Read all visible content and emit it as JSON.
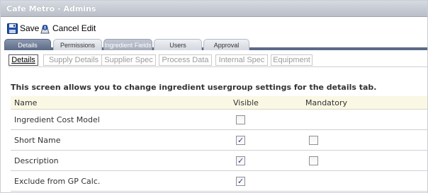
{
  "window": {
    "title": "Cafe Metro - Admins"
  },
  "toolbar": {
    "save_label": "Save",
    "cancel_label": "Cancel Edit",
    "save_icon": "floppy-disk-icon",
    "cancel_icon": "cancel-edit-icon"
  },
  "main_tabs": [
    {
      "label": "Details",
      "state": "active"
    },
    {
      "label": "Permissions",
      "state": "inactive"
    },
    {
      "label": "Ingredient Fields",
      "state": "selected"
    },
    {
      "label": "Users",
      "state": "inactive"
    },
    {
      "label": "Approval",
      "state": "inactive"
    }
  ],
  "sub_tabs": [
    {
      "label": "Details",
      "active": true
    },
    {
      "label": "Supply Details",
      "active": false
    },
    {
      "label": "Supplier Spec",
      "active": false
    },
    {
      "label": "Process Data",
      "active": false
    },
    {
      "label": "Internal Spec",
      "active": false
    },
    {
      "label": "Equipment",
      "active": false
    }
  ],
  "info_text": "This screen allows you to change ingredient usergroup settings for the details tab.",
  "grid": {
    "columns": {
      "name": "Name",
      "visible": "Visible",
      "mandatory": "Mandatory"
    },
    "rows": [
      {
        "name": "Ingredient Cost Model",
        "visible": false,
        "mandatory": null
      },
      {
        "name": "Short Name",
        "visible": true,
        "mandatory": false
      },
      {
        "name": "Description",
        "visible": true,
        "mandatory": false
      },
      {
        "name": "Exclude from GP Calc.",
        "visible": true,
        "mandatory": null
      }
    ]
  },
  "colors": {
    "tab_active": "#5b6a86",
    "header_bg": "#faf7e4",
    "check": "#27408b"
  }
}
